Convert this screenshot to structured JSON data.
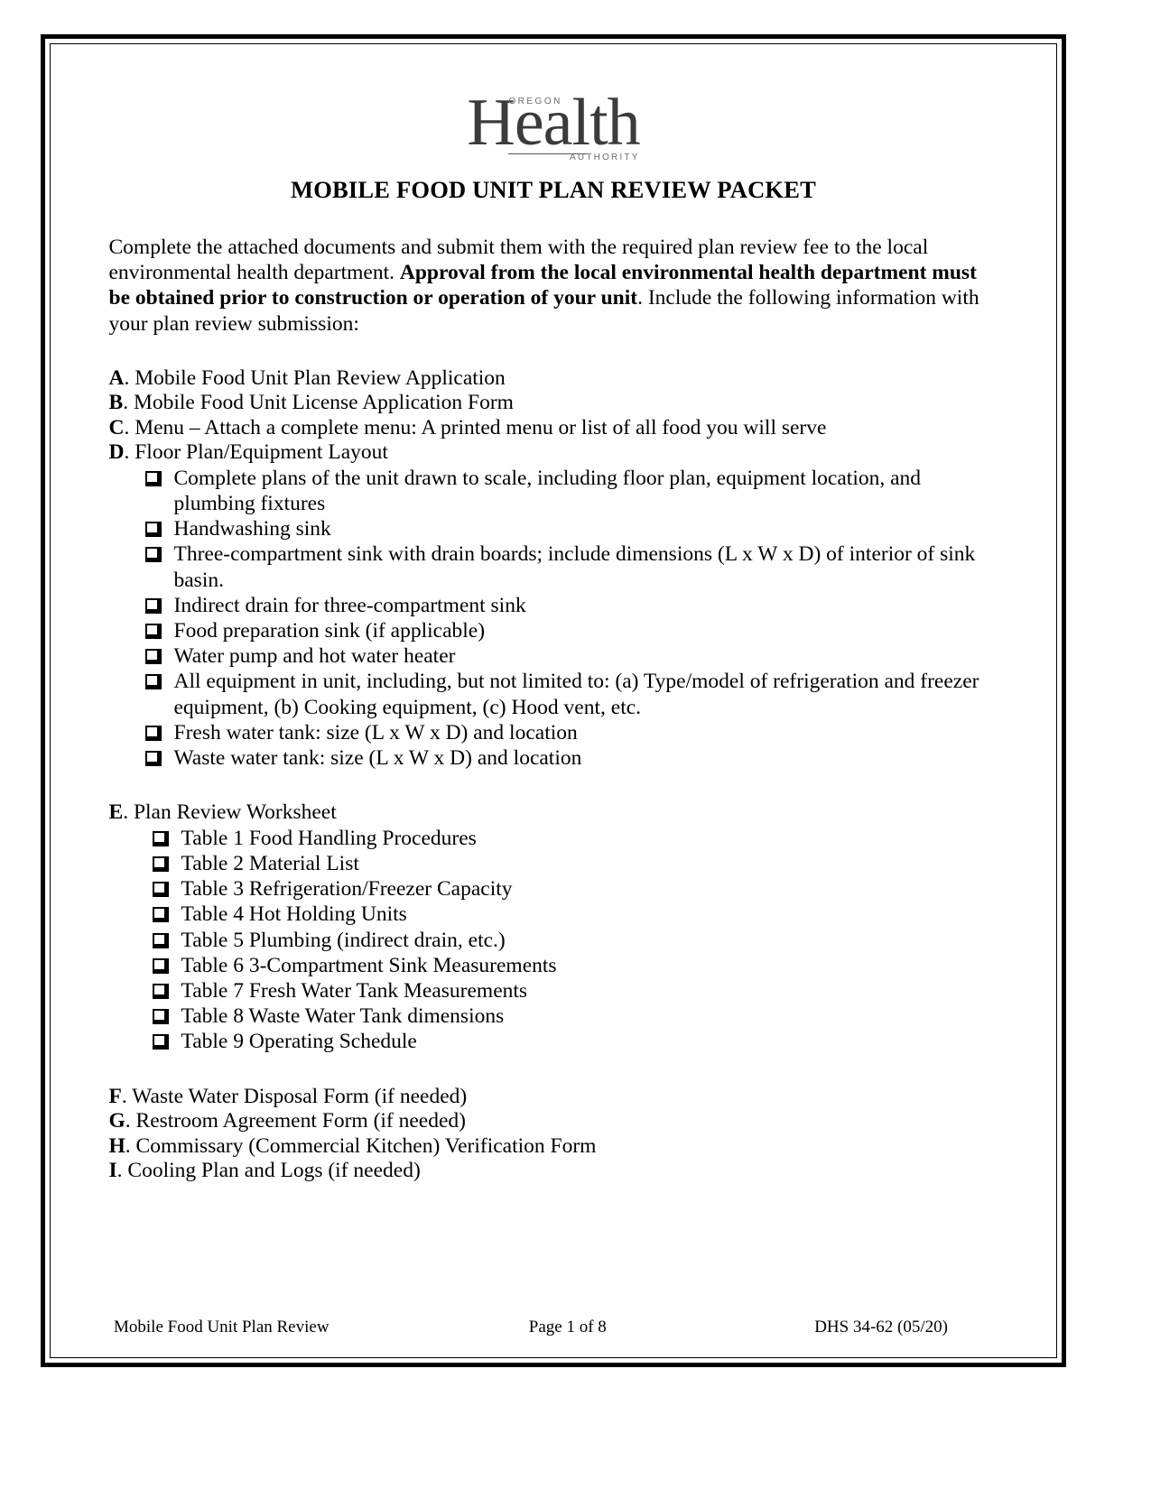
{
  "logo": {
    "icon": "oha-health-logo",
    "top_text": "OREGON",
    "main_text": "Health",
    "bottom_text": "AUTHORITY"
  },
  "document": {
    "title": "MOBILE FOOD UNIT PLAN REVIEW PACKET",
    "intro": {
      "part1": "Complete the attached documents and submit them with the required plan review fee to the local environmental health department. ",
      "bold": "Approval from the local environmental health department must be obtained prior to construction or operation of your unit",
      "part2": ". Include the following information with your plan review submission:"
    }
  },
  "sections": {
    "a": {
      "letter": "A",
      "label": ". Mobile Food Unit Plan Review Application"
    },
    "b": {
      "letter": "B",
      "label": ". Mobile Food Unit License Application Form"
    },
    "c": {
      "letter": "C",
      "label": ". Menu – Attach a complete menu: A printed menu or list of all food you will serve"
    },
    "d": {
      "letter": "D",
      "label": ". Floor Plan/Equipment Layout"
    },
    "e": {
      "letter": "E",
      "label": ". Plan Review Worksheet"
    },
    "f": {
      "letter": "F",
      "label": ". Waste Water Disposal Form (if needed)"
    },
    "g": {
      "letter": "G",
      "label": ". Restroom Agreement Form (if needed)"
    },
    "h": {
      "letter": "H",
      "label": ". Commissary (Commercial Kitchen) Verification Form"
    },
    "i": {
      "letter": "I",
      "label": ".  Cooling Plan and Logs (if needed)"
    }
  },
  "floor_plan_checklist": [
    "Complete plans of the unit drawn to scale, including floor plan, equipment location, and plumbing fixtures",
    "Handwashing sink",
    "Three-compartment sink with drain boards; include dimensions (L x W x D) of interior of sink basin.",
    "Indirect drain for three-compartment sink",
    "Food preparation sink (if applicable)",
    "Water pump and hot water heater",
    "All equipment in unit, including, but not limited to: (a) Type/model of refrigeration and freezer equipment, (b) Cooking equipment, (c) Hood vent, etc.",
    "Fresh water tank: size (L x W x D) and location",
    "Waste water tank: size (L x W x D) and location"
  ],
  "worksheet_checklist": [
    "Table 1 Food Handling Procedures",
    "Table 2 Material List",
    "Table 3 Refrigeration/Freezer Capacity",
    "Table 4 Hot Holding Units",
    "Table 5 Plumbing (indirect drain, etc.)",
    "Table 6 3-Compartment Sink Measurements",
    "Table 7 Fresh Water Tank Measurements",
    "Table 8 Waste Water Tank dimensions",
    "Table 9 Operating Schedule"
  ],
  "footer": {
    "left": "Mobile Food Unit Plan Review",
    "center": "Page 1 of 8",
    "right": "DHS 34-62 (05/20)"
  }
}
